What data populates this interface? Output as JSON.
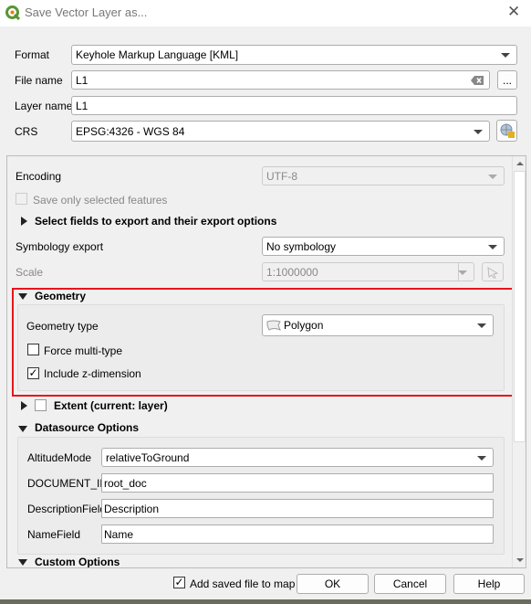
{
  "window": {
    "title": "Save Vector Layer as...",
    "icon": "qgis-logo-icon"
  },
  "form": {
    "format": {
      "label": "Format",
      "value": "Keyhole Markup Language [KML]"
    },
    "file_name": {
      "label": "File name",
      "value": "L1",
      "browse_label": "..."
    },
    "layer_name": {
      "label": "Layer name",
      "value": "L1"
    },
    "crs": {
      "label": "CRS",
      "value": "EPSG:4326 - WGS 84"
    }
  },
  "options": {
    "encoding": {
      "label": "Encoding",
      "value": "UTF-8"
    },
    "save_selected": {
      "label": "Save only selected features",
      "checked": false,
      "enabled": false
    },
    "select_fields": {
      "label": "Select fields to export and their export options",
      "expanded": false
    },
    "symbology": {
      "label": "Symbology export",
      "value": "No symbology"
    },
    "scale": {
      "label": "Scale",
      "value": "1:1000000"
    },
    "geometry": {
      "label": "Geometry",
      "expanded": true,
      "type_label": "Geometry type",
      "type_value": "Polygon",
      "force_multi": {
        "label": "Force multi-type",
        "checked": false
      },
      "include_z": {
        "label": "Include z-dimension",
        "checked": true
      },
      "highlight_color": "#e8141b"
    },
    "extent": {
      "label": "Extent (current: layer)",
      "checked": false,
      "expanded": false
    },
    "datasource": {
      "label": "Datasource Options",
      "expanded": true,
      "altitude_mode": {
        "label": "AltitudeMode",
        "value": "relativeToGround"
      },
      "document_id": {
        "label": "DOCUMENT_ID",
        "value": "root_doc"
      },
      "description_field": {
        "label": "DescriptionField",
        "value": "Description"
      },
      "name_field": {
        "label": "NameField",
        "value": "Name"
      }
    },
    "custom": {
      "label": "Custom Options"
    }
  },
  "footer": {
    "add_to_map": {
      "label": "Add saved file to map",
      "checked": true
    },
    "ok": "OK",
    "cancel": "Cancel",
    "help": "Help"
  }
}
